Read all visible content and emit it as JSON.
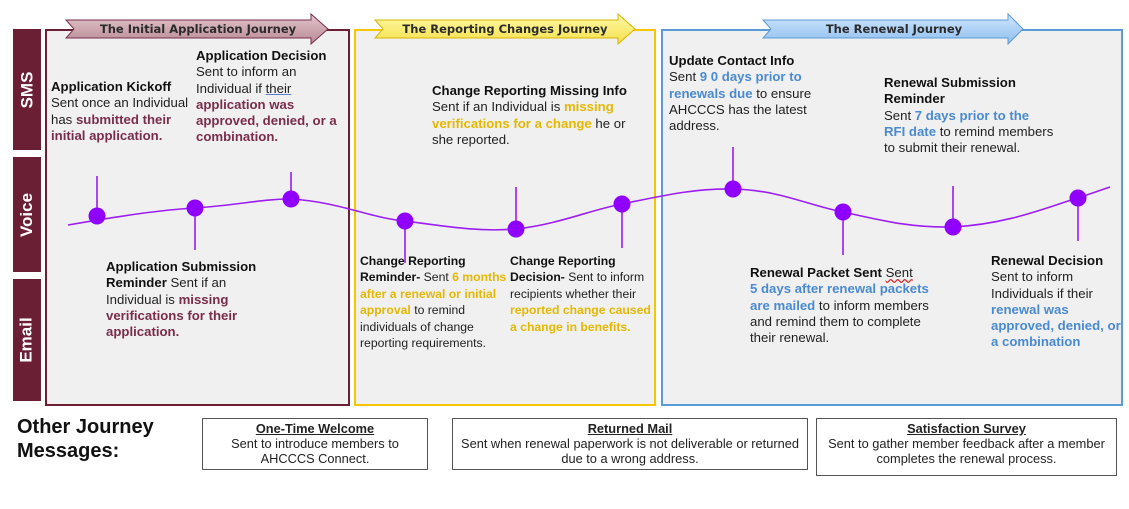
{
  "channels": [
    "SMS",
    "Voice",
    "Email"
  ],
  "journeys": [
    {
      "title": "The Initial Application Journey",
      "color": "#6b1f34",
      "arrow_fill": "#c9a0aa"
    },
    {
      "title": "The Reporting Changes Journey",
      "color": "#f6c700",
      "arrow_fill": "#fff27a"
    },
    {
      "title": "The Renewal Journey",
      "color": "#5b9bd5",
      "arrow_fill": "#a9cff2"
    }
  ],
  "timeline": {
    "line_color": "#9d1cf0",
    "point_color": "#9000ff",
    "points": [
      {
        "id": "application-kickoff",
        "stem": "up"
      },
      {
        "id": "application-submission-reminder",
        "stem": "down"
      },
      {
        "id": "application-decision",
        "stem": "up"
      },
      {
        "id": "change-reporting-reminder",
        "stem": "down"
      },
      {
        "id": "change-reporting-missing-info",
        "stem": "up"
      },
      {
        "id": "change-reporting-decision",
        "stem": "down"
      },
      {
        "id": "update-contact-info",
        "stem": "up"
      },
      {
        "id": "renewal-packet-sent",
        "stem": "down"
      },
      {
        "id": "renewal-submission-reminder",
        "stem": "up"
      },
      {
        "id": "renewal-decision",
        "stem": "down"
      }
    ]
  },
  "messages": {
    "application_kickoff": {
      "title": "Application  Kickoff",
      "text1": "Sent once an Individual has ",
      "highlight": "submitted  their initial application."
    },
    "application_decision": {
      "title": "Application Decision",
      "text1": "Sent to inform an Individual if ",
      "text_ul": "their",
      "highlight": " application  was approved,  denied, or a combination."
    },
    "application_submission_reminder": {
      "title": "Application Submission Reminder",
      "text1": " Sent if an Individual is ",
      "highlight": "missing verifications for their application."
    },
    "change_reporting_missing_info": {
      "title": "Change Reporting Missing Info",
      "text1": "Sent if an Individual is ",
      "highlight": "missing verifications for a change",
      "text2": " he or she reported."
    },
    "change_reporting_reminder": {
      "title": "Change Reporting Reminder-",
      "text1": " Sent ",
      "highlight": "6 months after a renewal or initial approval",
      "text2": " to remind individuals of change reporting requirements."
    },
    "change_reporting_decision": {
      "title": "Change Reporting Decision-",
      "text1": " Sent to inform recipients whether their ",
      "highlight": "reported change caused a change in benefits."
    },
    "update_contact_info": {
      "title": "Update Contact Info",
      "text1": "Sent ",
      "highlight": "9 0  days prior to renewals due",
      "text2": " to  ensure AHCCCS has the latest address."
    },
    "renewal_submission_reminder": {
      "title": "Renewal  Submission Reminder",
      "text1": "Sent ",
      "highlight": "7 days prior to the RFI date",
      "text2": " to remind members to submit their renewal."
    },
    "renewal_packet_sent": {
      "title": "Renewal  Packet Sent",
      "text_ul": "Sent",
      "highlight": "5 days after renewal packets  are mailed",
      "text2": " to inform members and remind them to complete their renewal."
    },
    "renewal_decision": {
      "title": "Renewal  Decision",
      "text1": "Sent to inform Individuals if their ",
      "highlight": "renewal  was approved,  denied, or a combination"
    }
  },
  "other": {
    "title_line1": "Other Journey",
    "title_line2": "Messages:",
    "boxes": [
      {
        "title": "One-Time Welcome",
        "text": "Sent to introduce members to AHCCCS Connect."
      },
      {
        "title": "Returned  Mail",
        "text": "Sent when renewal paperwork is not deliverable or returned due to a wrong address."
      },
      {
        "title": "Satisfaction  Survey",
        "text": "Sent to gather member feedback after a member completes the renewal process."
      }
    ]
  }
}
